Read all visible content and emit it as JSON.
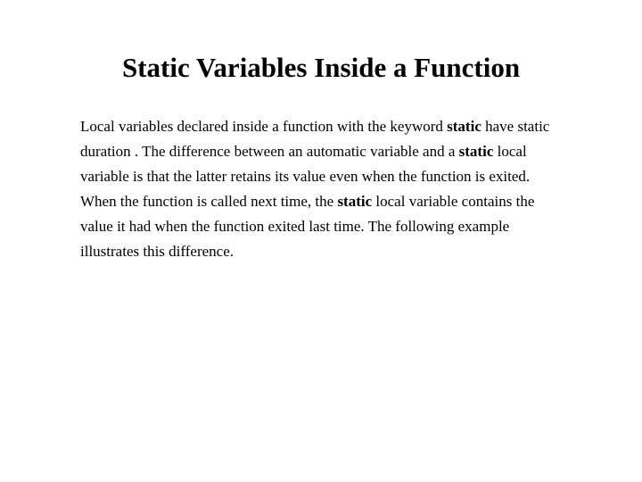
{
  "title": "Static Variables Inside a Function",
  "p": {
    "t1": "Local variables declared inside a function with the keyword ",
    "kw1": "static",
    "t2": " have static duration . The difference between an automatic variable and a ",
    "kw2": "static",
    "t3": " local variable is that the latter retains its value even when the function is exited. When the function is called next time, the ",
    "kw3": "static",
    "t4": " local variable contains the value it had when the function exited last time. The following example illustrates this difference."
  }
}
